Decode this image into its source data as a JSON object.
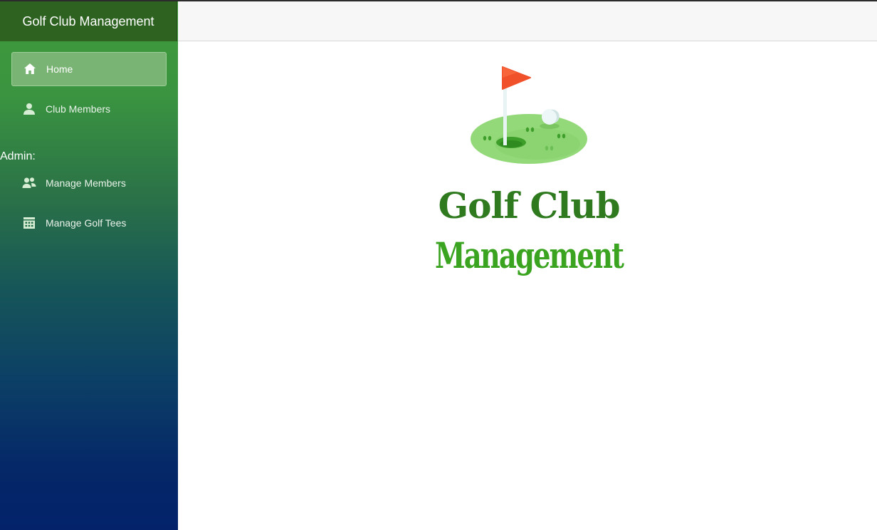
{
  "app": {
    "brand": "Golf Club Management"
  },
  "sidebar": {
    "items": [
      {
        "label": "Home",
        "icon": "home-icon",
        "active": true
      },
      {
        "label": "Club Members",
        "icon": "user-icon",
        "active": false
      }
    ],
    "admin_label": "Admin:",
    "admin_items": [
      {
        "label": "Manage Members",
        "icon": "users-icon"
      },
      {
        "label": "Manage Golf Tees",
        "icon": "calendar-icon"
      }
    ]
  },
  "logo": {
    "line1": "Golf Club",
    "line2": "Management",
    "colors": {
      "line1": "#2f7a1f",
      "line2": "#3aa31f",
      "flag": "#f0502a",
      "green": "#93d979"
    }
  },
  "colors": {
    "brand_bar": "#2d6220",
    "sidebar_top": "#3f9a3a",
    "sidebar_bottom": "#03226a",
    "active_item": "#7ab474"
  }
}
